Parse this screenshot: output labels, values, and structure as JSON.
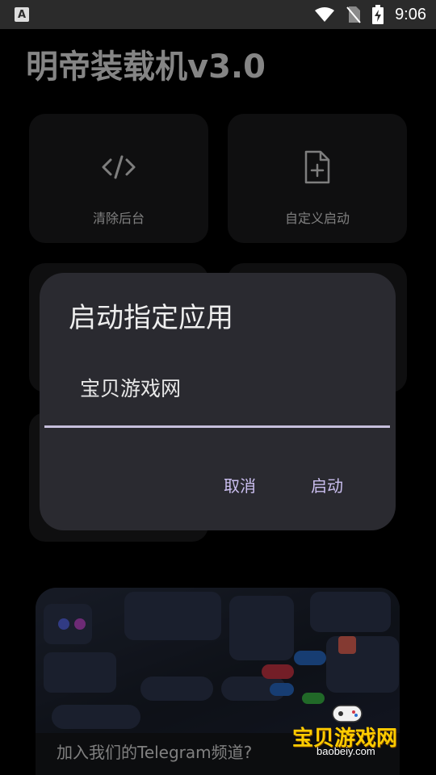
{
  "status_bar": {
    "time": "9:06",
    "left_icon": "A"
  },
  "app": {
    "title": "明帝装载机v3.0"
  },
  "tiles": [
    {
      "label": "清除后台",
      "icon": "code-icon"
    },
    {
      "label": "自定义启动",
      "icon": "file-add-icon"
    }
  ],
  "dialog": {
    "title": "启动指定应用",
    "input_value": "宝贝游戏网",
    "cancel_label": "取消",
    "confirm_label": "启动"
  },
  "banner": {
    "caption": "加入我们的Telegram频道?"
  },
  "watermark": {
    "title": "宝贝游戏网",
    "site": "baobeiy.com"
  },
  "colors": {
    "accent": "#cbbff0",
    "dialog_bg": "#2a2a30",
    "tile_bg": "#1c1c1e"
  }
}
